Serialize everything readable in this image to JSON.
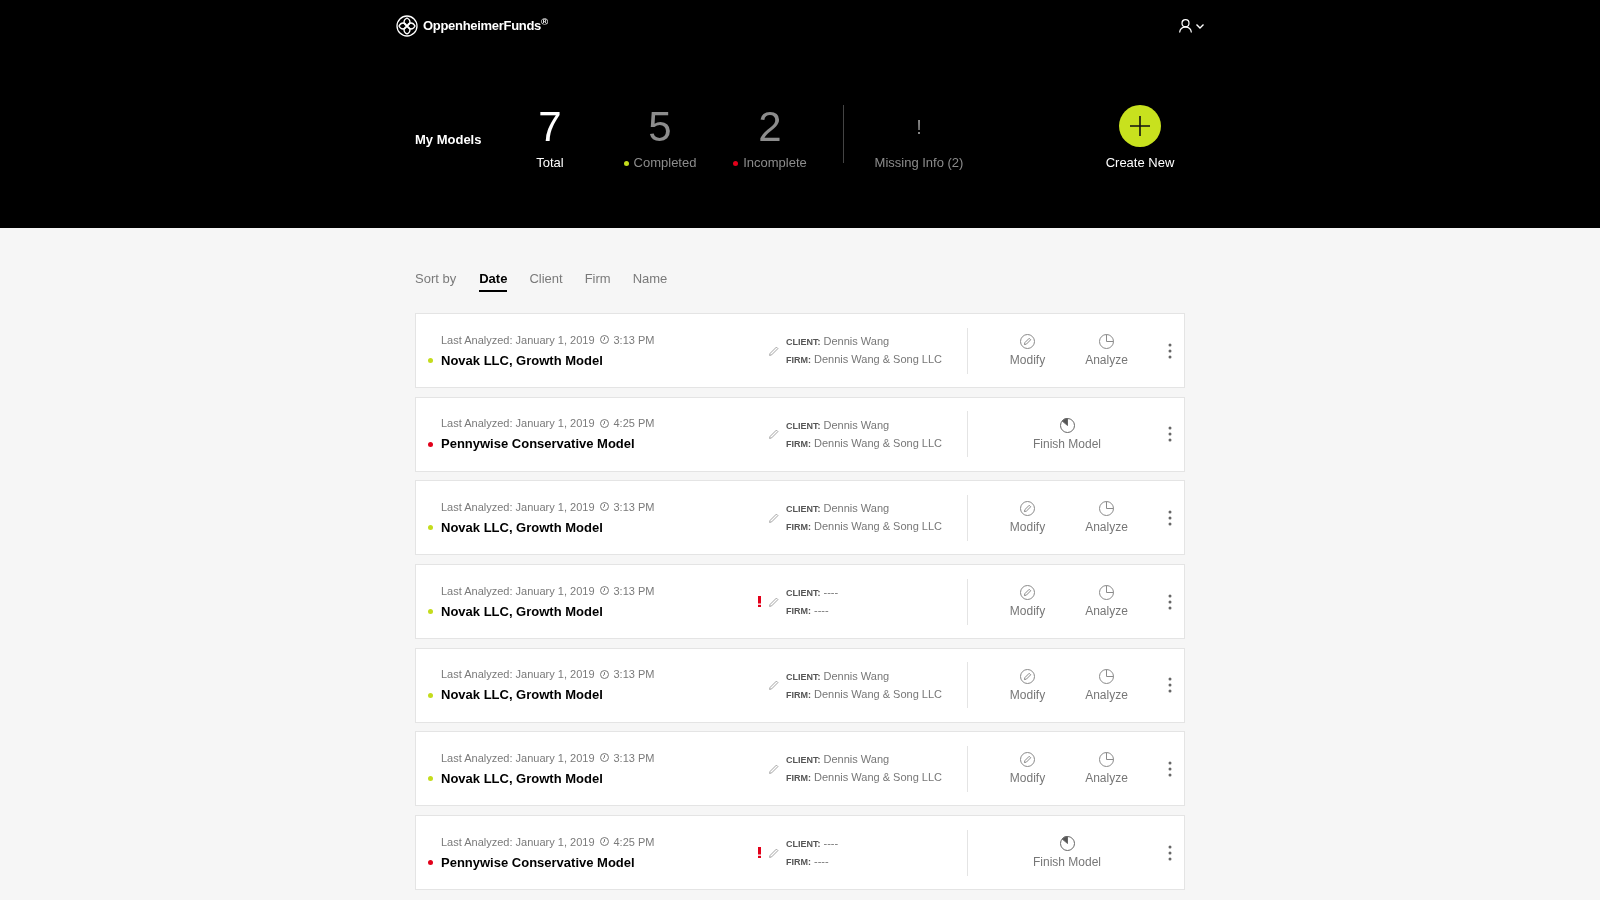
{
  "header": {
    "brand": "OppenheimerFunds$^{®}$"
  },
  "summary": {
    "title": "My Models",
    "stats": [
      {
        "kind": "primary",
        "value": "7",
        "label": "Total"
      },
      {
        "kind": "status",
        "value": "5",
        "label": "Completed",
        "color": "#c4dc1c"
      },
      {
        "kind": "status",
        "value": "2",
        "label": "Incomplete",
        "color": "#e2001a"
      },
      {
        "kind": "alert",
        "value": "!",
        "label": "Missing Info (2)"
      }
    ],
    "create_button": {
      "label": "Create New"
    }
  },
  "sort": {
    "label": "Sort by",
    "options": [
      {
        "label": "Date",
        "selected": true
      },
      {
        "label": "Client",
        "selected": false
      },
      {
        "label": "Firm",
        "selected": false
      },
      {
        "label": "Name",
        "selected": false
      }
    ]
  },
  "models": [
    {
      "color": "#c4dc1c",
      "last_analyzed": "Last Analyzed: January 1, 2019",
      "time": "3:13 PM",
      "name": "Novak LLC, Growth Model",
      "missing_info": false,
      "client_label": "CLIENT:",
      "client": "Dennis Wang",
      "firm_label": "FIRM:",
      "firm": "Dennis Wang & Song LLC",
      "actions": [
        {
          "kind": "modify",
          "label": "Modify"
        },
        {
          "kind": "analyze",
          "label": "Analyze"
        }
      ]
    },
    {
      "color": "#e2001a",
      "last_analyzed": "Last Analyzed: January 1, 2019",
      "time": "4:25 PM",
      "name": "Pennywise Conservative Model",
      "missing_info": false,
      "client_label": "CLIENT:",
      "client": "Dennis Wang",
      "firm_label": "FIRM:",
      "firm": "Dennis Wang & Song LLC",
      "actions": [
        {
          "kind": "finish",
          "label": "Finish Model"
        }
      ]
    },
    {
      "color": "#c4dc1c",
      "last_analyzed": "Last Analyzed: January 1, 2019",
      "time": "3:13 PM",
      "name": "Novak LLC, Growth Model",
      "missing_info": false,
      "client_label": "CLIENT:",
      "client": "Dennis Wang",
      "firm_label": "FIRM:",
      "firm": "Dennis Wang & Song LLC",
      "actions": [
        {
          "kind": "modify",
          "label": "Modify"
        },
        {
          "kind": "analyze",
          "label": "Analyze"
        }
      ]
    },
    {
      "color": "#c4dc1c",
      "last_analyzed": "Last Analyzed: January 1, 2019",
      "time": "3:13 PM",
      "name": "Novak LLC, Growth Model",
      "missing_info": true,
      "client_label": "CLIENT:",
      "client": "----",
      "firm_label": "FIRM:",
      "firm": "----",
      "actions": [
        {
          "kind": "modify",
          "label": "Modify"
        },
        {
          "kind": "analyze",
          "label": "Analyze"
        }
      ]
    },
    {
      "color": "#c4dc1c",
      "last_analyzed": "Last Analyzed: January 1, 2019",
      "time": "3:13 PM",
      "name": "Novak LLC, Growth Model",
      "missing_info": false,
      "client_label": "CLIENT:",
      "client": "Dennis Wang",
      "firm_label": "FIRM:",
      "firm": "Dennis Wang & Song LLC",
      "actions": [
        {
          "kind": "modify",
          "label": "Modify"
        },
        {
          "kind": "analyze",
          "label": "Analyze"
        }
      ]
    },
    {
      "color": "#c4dc1c",
      "last_analyzed": "Last Analyzed: January 1, 2019",
      "time": "3:13 PM",
      "name": "Novak LLC, Growth Model",
      "missing_info": false,
      "client_label": "CLIENT:",
      "client": "Dennis Wang",
      "firm_label": "FIRM:",
      "firm": "Dennis Wang & Song LLC",
      "actions": [
        {
          "kind": "modify",
          "label": "Modify"
        },
        {
          "kind": "analyze",
          "label": "Analyze"
        }
      ]
    },
    {
      "color": "#e2001a",
      "last_analyzed": "Last Analyzed: January 1, 2019",
      "time": "4:25 PM",
      "name": "Pennywise Conservative Model",
      "missing_info": true,
      "client_label": "CLIENT:",
      "client": "----",
      "firm_label": "FIRM:",
      "firm": "----",
      "actions": [
        {
          "kind": "finish",
          "label": "Finish Model"
        }
      ]
    }
  ]
}
